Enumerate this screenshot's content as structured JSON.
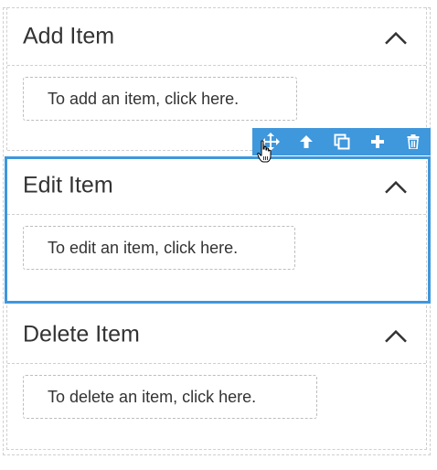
{
  "sections": [
    {
      "title": "Add Item",
      "button": "To add an item, click here."
    },
    {
      "title": "Edit Item",
      "button": "To edit an item, click here."
    },
    {
      "title": "Delete Item",
      "button": "To delete an item, click here."
    }
  ],
  "toolbar": {
    "icons": [
      "move-icon",
      "move-up-icon",
      "duplicate-icon",
      "add-icon",
      "delete-icon"
    ]
  },
  "colors": {
    "accent": "#3f97dc",
    "text": "#333333",
    "dashed_border": "#cfcfcf"
  }
}
